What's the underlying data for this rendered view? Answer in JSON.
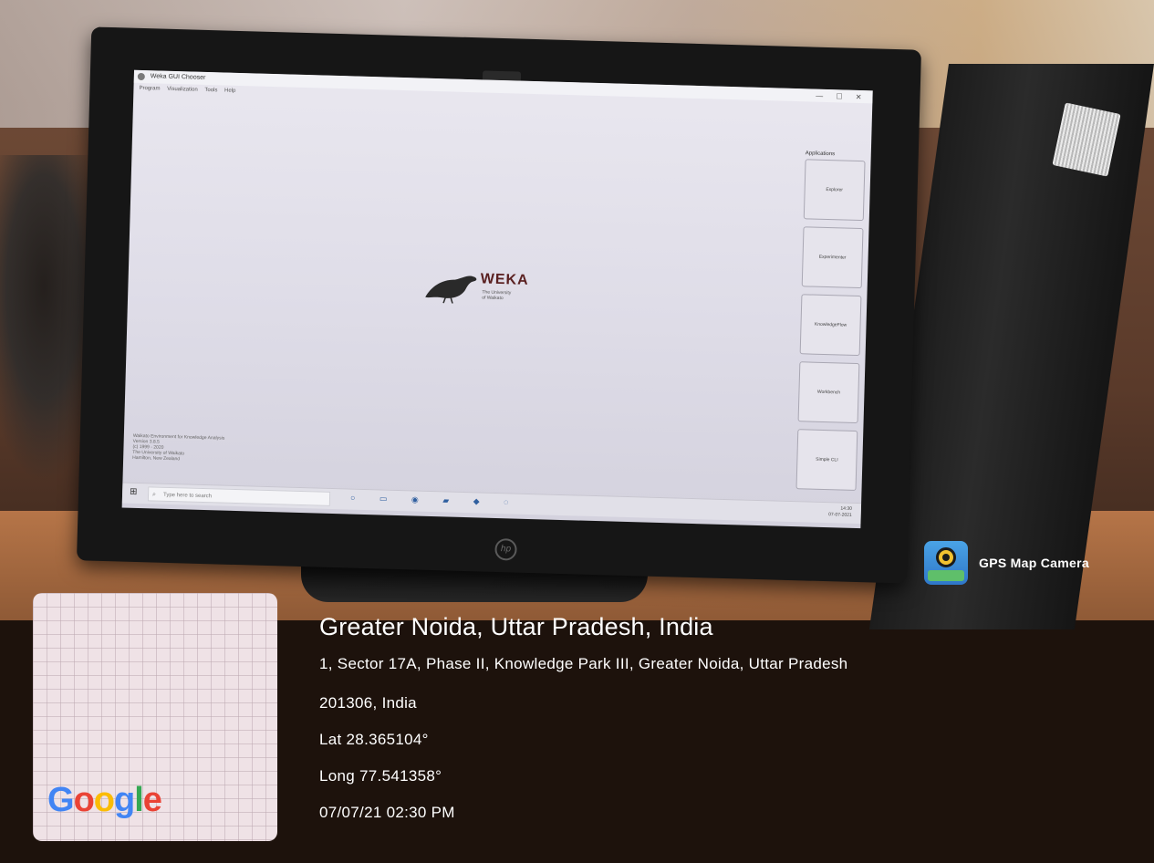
{
  "screen": {
    "window_title": "Weka GUI Chooser",
    "menu": [
      "Program",
      "Visualization",
      "Tools",
      "Help"
    ],
    "window_controls": "— ☐ ✕",
    "logo": {
      "name": "WEKA",
      "subtitle_line1": "The University",
      "subtitle_line2": "of Waikato"
    },
    "applications_title": "Applications",
    "application_buttons": [
      "Explorer",
      "Experimenter",
      "KnowledgeFlow",
      "Workbench",
      "Simple CLI"
    ],
    "info_text": [
      "Waikato Environment for Knowledge Analysis",
      "Version 3.8.5",
      "(c) 1999 - 2020",
      "The University of Waikato",
      "Hamilton, New Zealand"
    ],
    "taskbar": {
      "search_placeholder": "Type here to search",
      "clock_time": "14:30",
      "clock_date": "07-07-2021"
    }
  },
  "gps": {
    "app_name": "GPS Map Camera",
    "map_provider": "Google",
    "city": "Greater Noida, Uttar Pradesh, India",
    "address_line1": "1, Sector 17A, Phase II, Knowledge Park III, Greater Noida, Uttar Pradesh",
    "address_line2": "201306, India",
    "lat": "Lat 28.365104°",
    "long": "Long 77.541358°",
    "datetime": "07/07/21 02:30 PM"
  },
  "colors": {
    "google_blue": "#4285f4",
    "google_red": "#ea4335",
    "google_yellow": "#fbbc05",
    "google_green": "#34a853",
    "overlay_text": "#ffffff"
  },
  "icons": [
    "windows-start-icon",
    "search-icon",
    "weka-bird-icon",
    "gps-map-camera-icon",
    "hp-logo-icon"
  ]
}
